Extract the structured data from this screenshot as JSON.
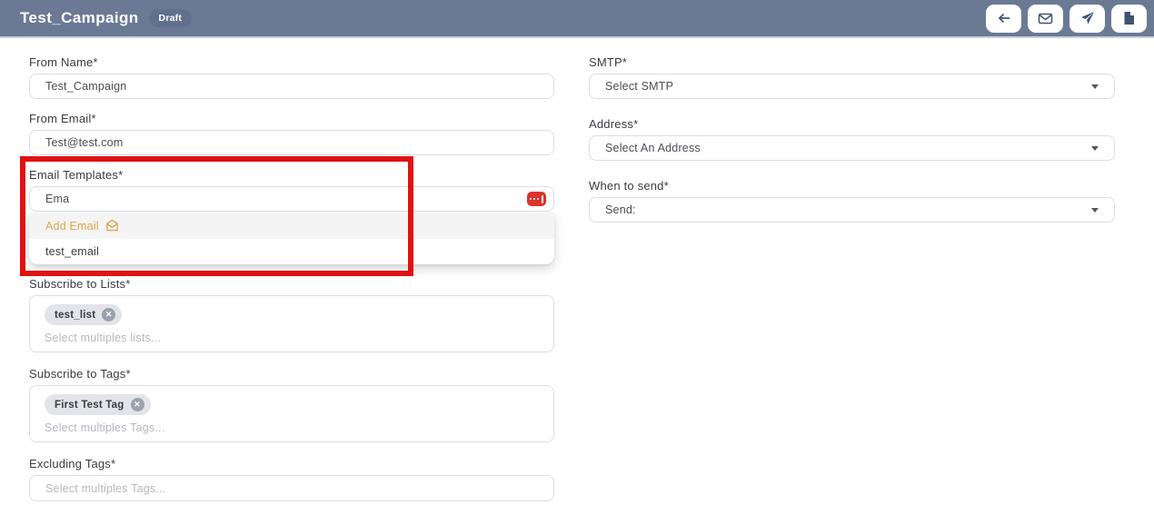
{
  "header": {
    "title": "Test_Campaign",
    "status_badge": "Draft",
    "buttons": [
      {
        "name": "back",
        "icon": "arrow-left-icon"
      },
      {
        "name": "email",
        "icon": "envelope-icon"
      },
      {
        "name": "send",
        "icon": "paper-plane-icon"
      },
      {
        "name": "document",
        "icon": "file-icon"
      }
    ]
  },
  "form": {
    "left": {
      "from_name": {
        "label": "From Name*",
        "value": "Test_Campaign"
      },
      "from_email": {
        "label": "From Email*",
        "value": "Test@test.com"
      },
      "email_templates": {
        "label": "Email Templates*",
        "value": "Ema",
        "badge_icon": "ellipsis-badge-icon",
        "dropdown": {
          "add_label": "Add Email",
          "add_icon": "envelope-open-icon",
          "options": [
            "test_email"
          ]
        }
      },
      "subscribe_lists": {
        "label": "Subscribe to Lists*",
        "chips": [
          "test_list"
        ],
        "placeholder": "Select multiples lists..."
      },
      "subscribe_tags": {
        "label": "Subscribe to Tags*",
        "chips": [
          "First Test Tag"
        ],
        "placeholder": "Select multiples Tags..."
      },
      "excluding_tags": {
        "label": "Excluding Tags*",
        "placeholder": "Select multiples Tags..."
      }
    },
    "right": {
      "smtp": {
        "label": "SMTP*",
        "value": "Select SMTP"
      },
      "address": {
        "label": "Address*",
        "value": "Select An Address"
      },
      "when_to_send": {
        "label": "When to send*",
        "value": "Send:"
      }
    }
  },
  "colors": {
    "header_bg": "#6a7a94",
    "badge_bg": "#61708c",
    "icon_color": "#3d5472",
    "add_email_color": "#dfa64a",
    "red_badge": "#d7342c",
    "annotation_red": "#e01212",
    "chip_bg": "#e3e4e9"
  }
}
